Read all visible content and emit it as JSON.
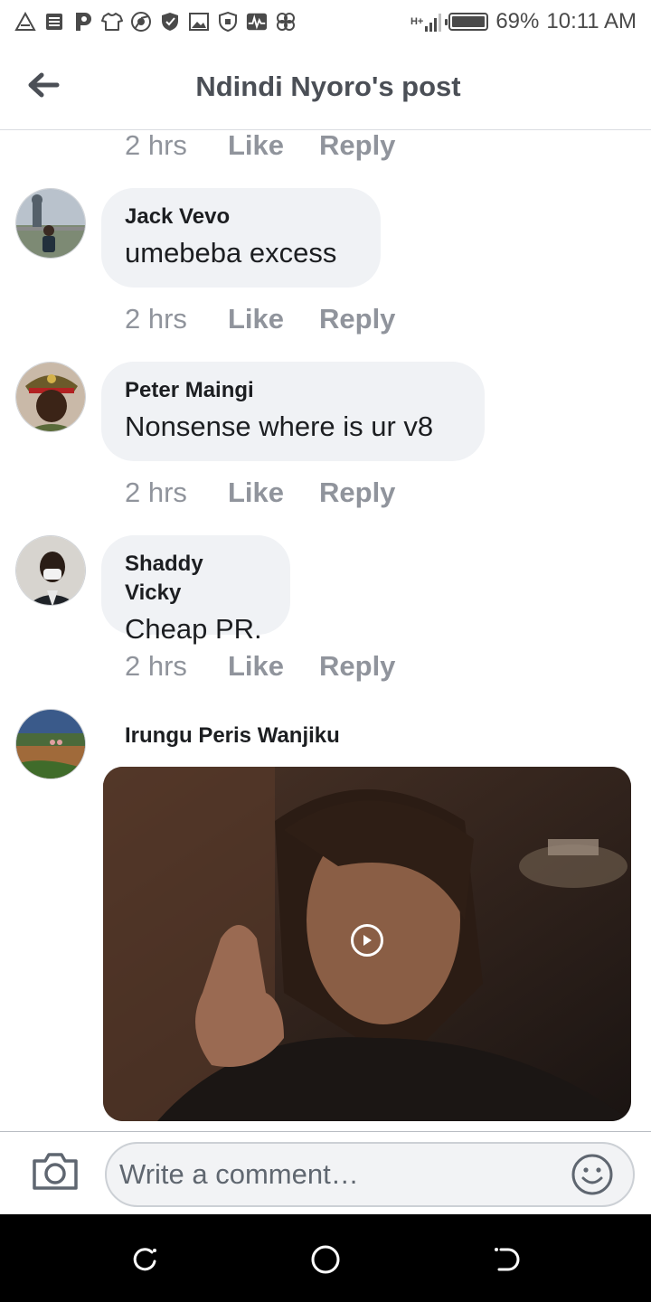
{
  "status_bar": {
    "notification_icons": [
      "warning-icon",
      "news-icon",
      "p-app-icon",
      "shirt-icon",
      "chrome-icon",
      "shield-icon",
      "gallery-icon",
      "security-icon",
      "pulse-icon",
      "dropbox-icon"
    ],
    "network_label": "H+",
    "battery": "69%",
    "time": "10:11 AM"
  },
  "header": {
    "title": "Ndindi Nyoro's post"
  },
  "comments": [
    {
      "author": "",
      "text": "",
      "time": "2 hrs",
      "like": "Like",
      "reply": "Reply"
    },
    {
      "author": "Jack Vevo",
      "text": "umebeba excess",
      "time": "2 hrs",
      "like": "Like",
      "reply": "Reply"
    },
    {
      "author": "Peter Maingi",
      "text": "Nonsense where is ur v8",
      "time": "2 hrs",
      "like": "Like",
      "reply": "Reply"
    },
    {
      "author": "Shaddy Vicky",
      "text": "Cheap PR.",
      "time": "2 hrs",
      "like": "Like",
      "reply": "Reply"
    },
    {
      "author": "Irungu Peris Wanjiku",
      "attachment": "gif"
    }
  ],
  "composer": {
    "placeholder": "Write a comment…"
  },
  "colors": {
    "bubble": "#f0f2f5",
    "meta_text": "#90949c",
    "header_text": "#4b4f56",
    "nav_bar": "#000000"
  }
}
